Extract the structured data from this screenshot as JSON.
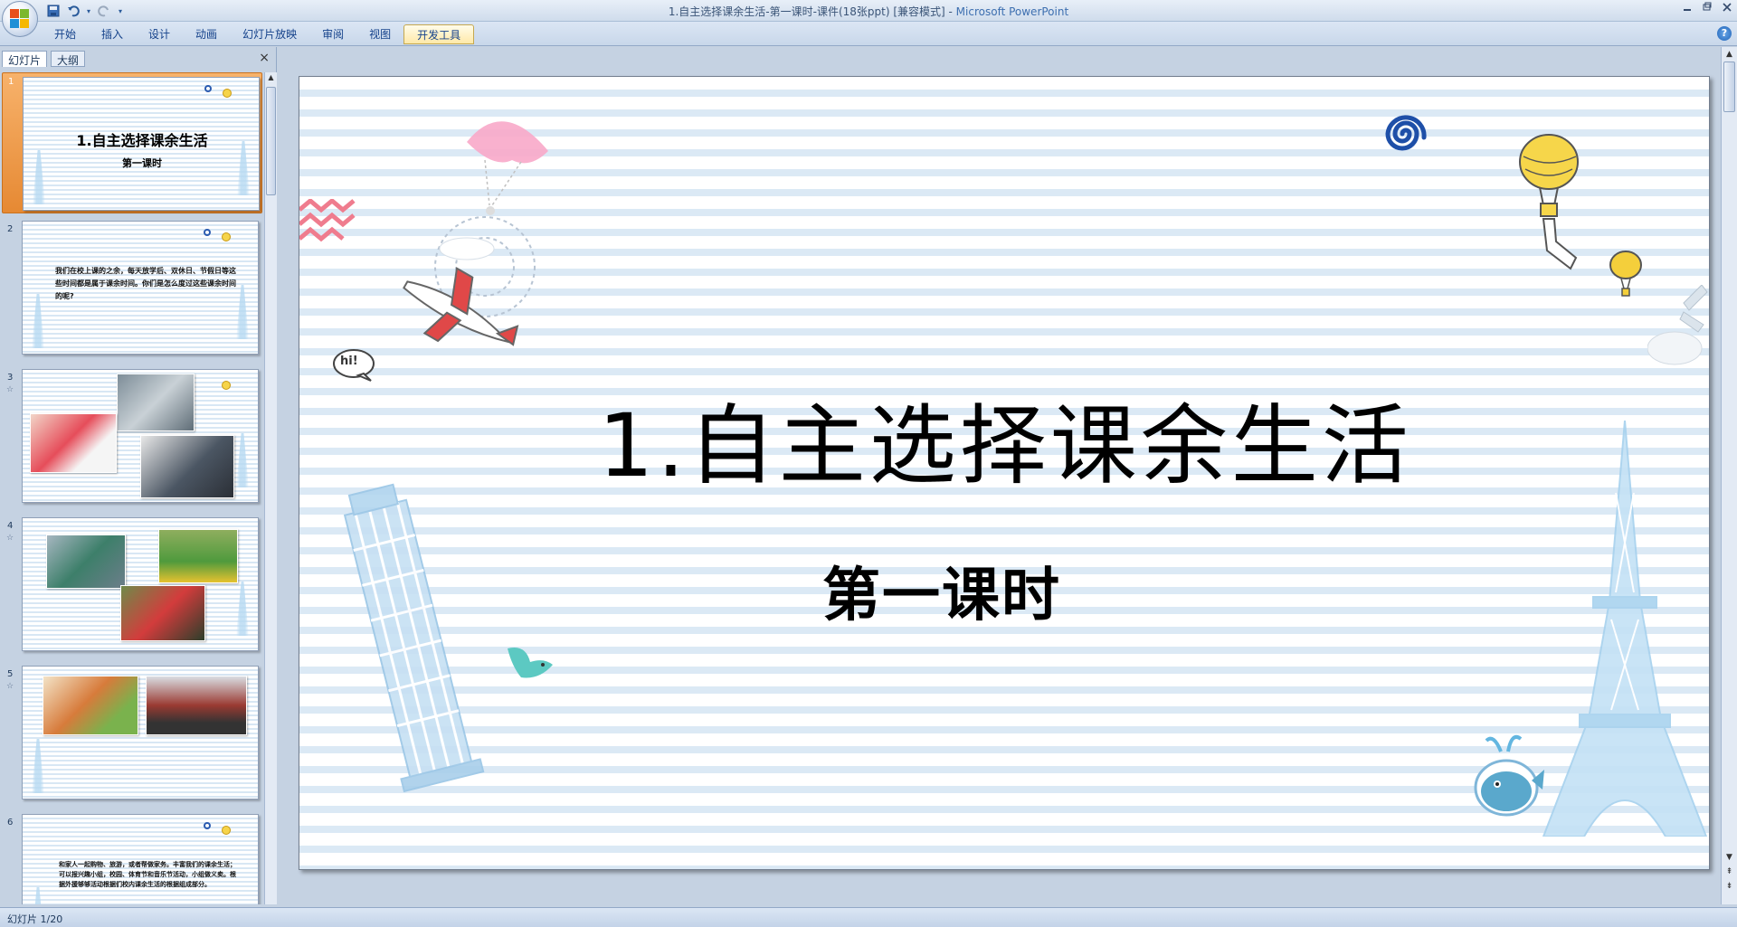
{
  "window": {
    "document_title": "1.自主选择课余生活-第一课时-课件(18张ppt) [兼容模式]",
    "separator": " - ",
    "app_name": "Microsoft PowerPoint"
  },
  "ribbon": {
    "tabs": [
      {
        "label": "开始"
      },
      {
        "label": "插入"
      },
      {
        "label": "设计"
      },
      {
        "label": "动画"
      },
      {
        "label": "幻灯片放映"
      },
      {
        "label": "审阅"
      },
      {
        "label": "视图"
      },
      {
        "label": "开发工具"
      }
    ],
    "help_glyph": "?"
  },
  "left_pane": {
    "tabs": [
      {
        "label": "幻灯片"
      },
      {
        "label": "大纲"
      }
    ],
    "close_glyph": "×",
    "thumbnails": [
      {
        "number": "1",
        "title": "1.自主选择课余生活",
        "subtitle": "第一课时"
      },
      {
        "number": "2",
        "text": "我们在校上课的之余，每天放学后、双休日、节假日等这些时间都是属于课余时间。你们是怎么度过这些课余时间的呢?"
      },
      {
        "number": "3",
        "anim": "☆"
      },
      {
        "number": "4",
        "anim": "☆"
      },
      {
        "number": "5",
        "anim": "☆"
      },
      {
        "number": "6",
        "text": "和家人一起购物、旅游，或者帮做家务。丰富我们的课余生活；可以报兴趣小组，校园、体育节和音乐节活动，小组做义卖。根据外援够够活动根据们校内课余生活的根据组成部分。"
      }
    ]
  },
  "slide": {
    "title": "1.自主选择课余生活",
    "subtitle": "第一课时",
    "hi_text": "hi!"
  },
  "statusbar": {
    "slide_indicator": "幻灯片 1/20"
  },
  "colors": {
    "accent": "#15428b",
    "selected_thumb": "#e68933",
    "stripe": "#dbe9f5"
  }
}
